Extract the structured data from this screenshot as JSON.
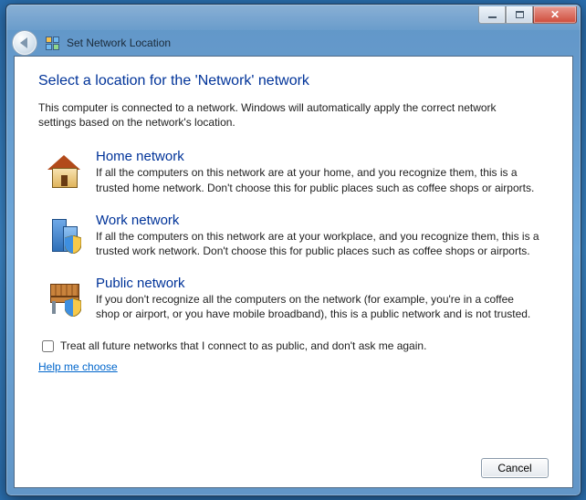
{
  "window": {
    "title": "Set Network Location"
  },
  "heading": "Select a location for the 'Network' network",
  "intro": "This computer is connected to a network. Windows will automatically apply the correct network settings based on the network's location.",
  "options": [
    {
      "title": "Home network",
      "desc": "If all the computers on this network are at your home, and you recognize them, this is a trusted home network.  Don't choose this for public places such as coffee shops or airports."
    },
    {
      "title": "Work network",
      "desc": "If all the computers on this network are at your workplace, and you recognize them, this is a trusted work network.  Don't choose this for public places such as coffee shops or airports."
    },
    {
      "title": "Public network",
      "desc": "If you don't recognize all the computers on the network (for example, you're in a coffee shop or airport, or you have mobile broadband), this is a public network and is not trusted."
    }
  ],
  "checkbox_label": "Treat all future networks that I connect to as public, and don't ask me again.",
  "help_link": "Help me choose",
  "buttons": {
    "cancel": "Cancel"
  }
}
